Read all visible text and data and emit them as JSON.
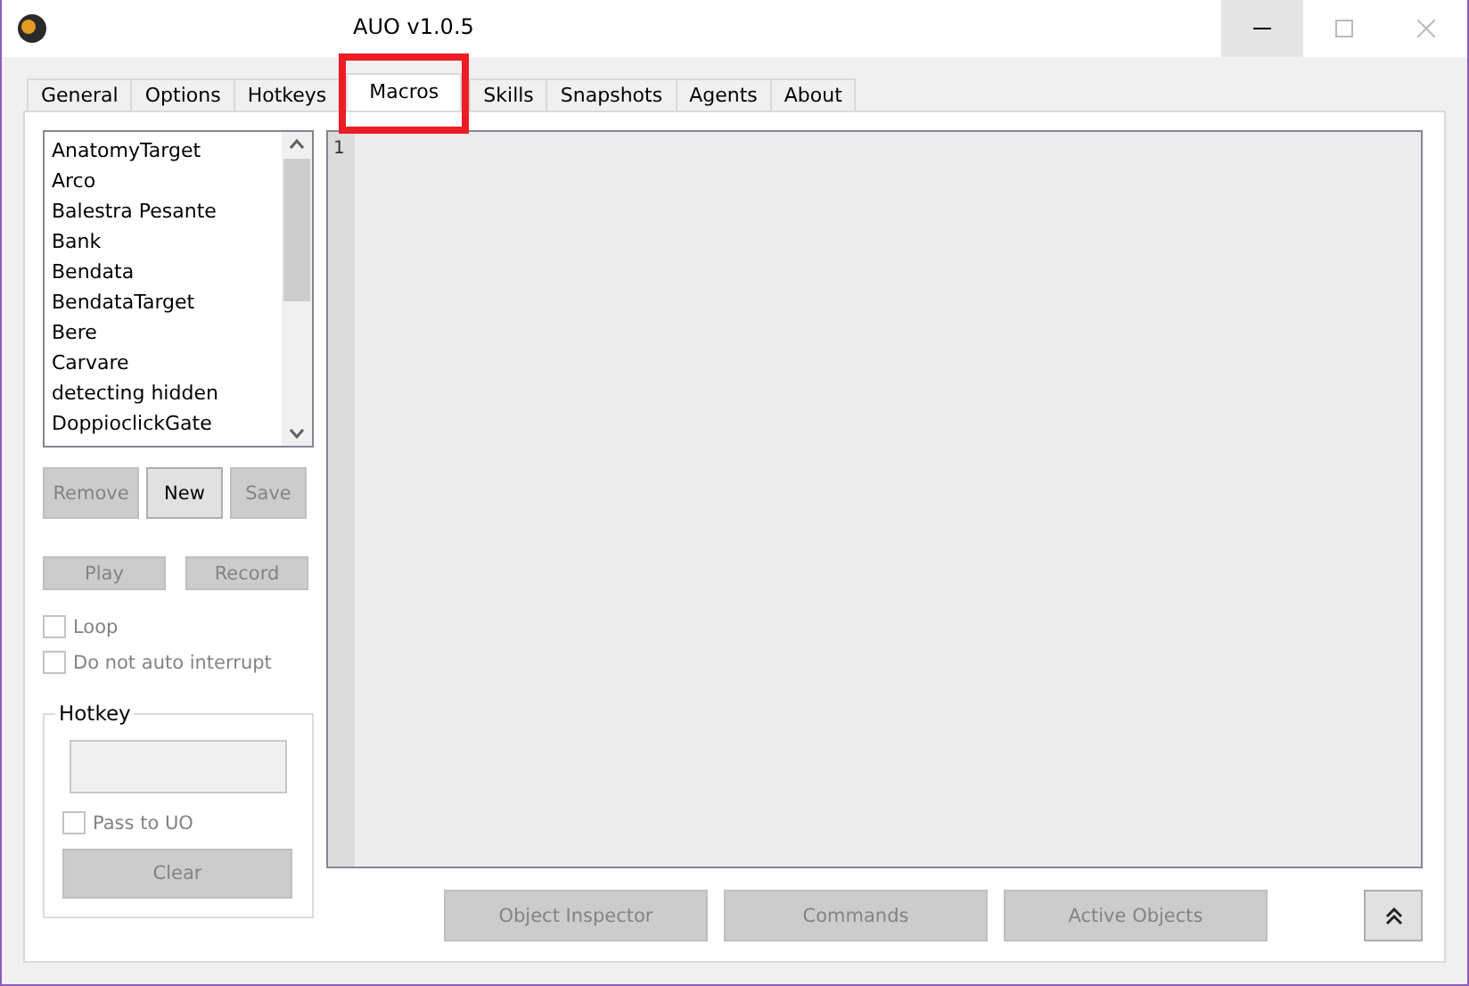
{
  "window": {
    "title": "AUO v1.0.5"
  },
  "tabs": [
    {
      "label": "General",
      "selected": false
    },
    {
      "label": "Options",
      "selected": false
    },
    {
      "label": "Hotkeys",
      "selected": false
    },
    {
      "label": "Macros",
      "selected": true
    },
    {
      "label": "Skills",
      "selected": false
    },
    {
      "label": "Snapshots",
      "selected": false
    },
    {
      "label": "Agents",
      "selected": false
    },
    {
      "label": "About",
      "selected": false
    }
  ],
  "macro_list": [
    "AnatomyTarget",
    "Arco",
    "Balestra Pesante",
    "Bank",
    "Bendata",
    "BendataTarget",
    "Bere",
    "Carvare",
    "detecting hidden",
    "DoppioclickGate"
  ],
  "list_buttons": [
    {
      "label": "Remove",
      "disabled": true
    },
    {
      "label": "New",
      "disabled": false
    },
    {
      "label": "Save",
      "disabled": true
    }
  ],
  "play_buttons": [
    {
      "label": "Play",
      "disabled": true
    },
    {
      "label": "Record",
      "disabled": true
    }
  ],
  "options": [
    {
      "label": "Loop",
      "checked": false
    },
    {
      "label": "Do not auto interrupt",
      "checked": false
    }
  ],
  "hotkey": {
    "title": "Hotkey",
    "pass_to_uo": {
      "label": "Pass to UO",
      "checked": false
    },
    "clear": {
      "label": "Clear",
      "disabled": true
    }
  },
  "editor": {
    "line_numbers": [
      "1"
    ]
  },
  "bottom_buttons": [
    {
      "label": "Object Inspector",
      "disabled": true
    },
    {
      "label": "Commands",
      "disabled": true
    },
    {
      "label": "Active Objects",
      "disabled": true
    }
  ]
}
